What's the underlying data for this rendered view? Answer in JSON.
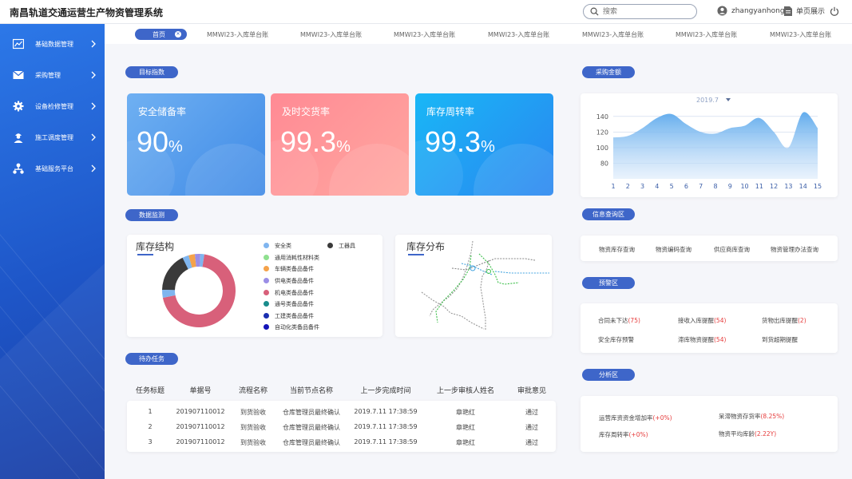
{
  "app": {
    "title": "南昌轨道交通运营生产物资管理系统"
  },
  "header": {
    "search_placeholder": "搜索",
    "username": "zhangyanhong",
    "single_page": "单页展示"
  },
  "sidebar": {
    "items": [
      {
        "label": "基础数据管理",
        "icon": "chart-icon"
      },
      {
        "label": "采购管理",
        "icon": "mail-icon"
      },
      {
        "label": "设备检修管理",
        "icon": "gear-icon"
      },
      {
        "label": "施工调度管理",
        "icon": "worker-icon"
      },
      {
        "label": "基础服务平台",
        "icon": "org-icon"
      }
    ]
  },
  "tabs": {
    "home": "首页",
    "items": [
      "MMWI23-入库单台账",
      "MMWI23-入库单台账",
      "MMWI23-入库单台账",
      "MMWI23-入库单台账",
      "MMWI23-入库单台账",
      "MMWI23-入库单台账",
      "MMWI23-入库单台账"
    ]
  },
  "sections": {
    "target": "目标指数",
    "monitor": "数据监测",
    "todo": "待办任务",
    "purchase": "采购金额",
    "info": "信息查询区",
    "warning": "预警区",
    "analysis": "分析区"
  },
  "kpis": [
    {
      "label": "安全储备率",
      "value": "90",
      "unit": "%",
      "color_from": "#6fb0f2",
      "color_to": "#3f8ae6"
    },
    {
      "label": "及时交货率",
      "value": "99.3",
      "unit": "%",
      "color_from": "#ff8a94",
      "color_to": "#ffa7a0"
    },
    {
      "label": "库存周转率",
      "value": "99.3",
      "unit": "%",
      "color_from": "#19b7f6",
      "color_to": "#2a86f0"
    }
  ],
  "inventory_structure": {
    "title": "库存结构",
    "legend": [
      {
        "label": "安全类",
        "color": "#7fb5ef"
      },
      {
        "label": "工器具",
        "color": "#3a3a3a"
      },
      {
        "label": "通用消耗性材料类",
        "color": "#8fe08f"
      },
      {
        "label": "车辆类备品备件",
        "color": "#f5a24a"
      },
      {
        "label": "供电类备品备件",
        "color": "#9b8ee6"
      },
      {
        "label": "机电类备品备件",
        "color": "#d8607a"
      },
      {
        "label": "通号类备品备件",
        "color": "#1a8c8c"
      },
      {
        "label": "工建类备品备件",
        "color": "#1a2fb0"
      },
      {
        "label": "自动化类备品备件",
        "color": "#1414b8"
      }
    ]
  },
  "inventory_distribution": {
    "title": "库存分布"
  },
  "chart_data": {
    "type": "area",
    "selector": "2019.7",
    "x": [
      1,
      2,
      3,
      4,
      5,
      6,
      7,
      8,
      9,
      10,
      11,
      12,
      13,
      14,
      15
    ],
    "y": [
      113,
      115,
      125,
      138,
      143,
      130,
      120,
      118,
      125,
      128,
      138,
      120,
      100,
      145,
      125
    ],
    "yticks": [
      80,
      100,
      120,
      140
    ],
    "ylim": [
      60,
      150
    ],
    "grid": true
  },
  "todo": {
    "headers": [
      "任务标题",
      "单据号",
      "流程名称",
      "当前节点名称",
      "上一步完成时间",
      "上一步审核人姓名",
      "审批意见"
    ],
    "rows": [
      [
        "1",
        "201907110012",
        "到货验收",
        "仓库管理员最终确认",
        "2019.7.11 17:38:59",
        "章艳红",
        "通过"
      ],
      [
        "2",
        "201907110012",
        "到货验收",
        "仓库管理员最终确认",
        "2019.7.11 17:38:59",
        "章艳红",
        "通过"
      ],
      [
        "3",
        "201907110012",
        "到货验收",
        "仓库管理员最终确认",
        "2019.7.11 17:38:59",
        "章艳红",
        "通过"
      ]
    ]
  },
  "info": {
    "links": [
      "物资库存查询",
      "物资编码查询",
      "供应商库查询",
      "物资管理办法查询"
    ]
  },
  "warning": {
    "items": [
      {
        "label": "合同未下达",
        "count": "(75)"
      },
      {
        "label": "接收入库提醒",
        "count": "(54)"
      },
      {
        "label": "货物出库提醒",
        "count": "(2)"
      },
      {
        "label": "安全库存预警",
        "count": ""
      },
      {
        "label": "滞库物资提醒",
        "count": "(54)"
      },
      {
        "label": "到货超期提醒",
        "count": ""
      }
    ]
  },
  "analysis": {
    "items": [
      {
        "label": "运营库资资金增加率",
        "value": "(+0%)"
      },
      {
        "label": "呆滞物资存货率",
        "value": "(8.25%)"
      },
      {
        "label": "库存周转率",
        "value": "(+0%)"
      },
      {
        "label": "物资平均库龄",
        "value": "(2.22Y)"
      }
    ]
  }
}
